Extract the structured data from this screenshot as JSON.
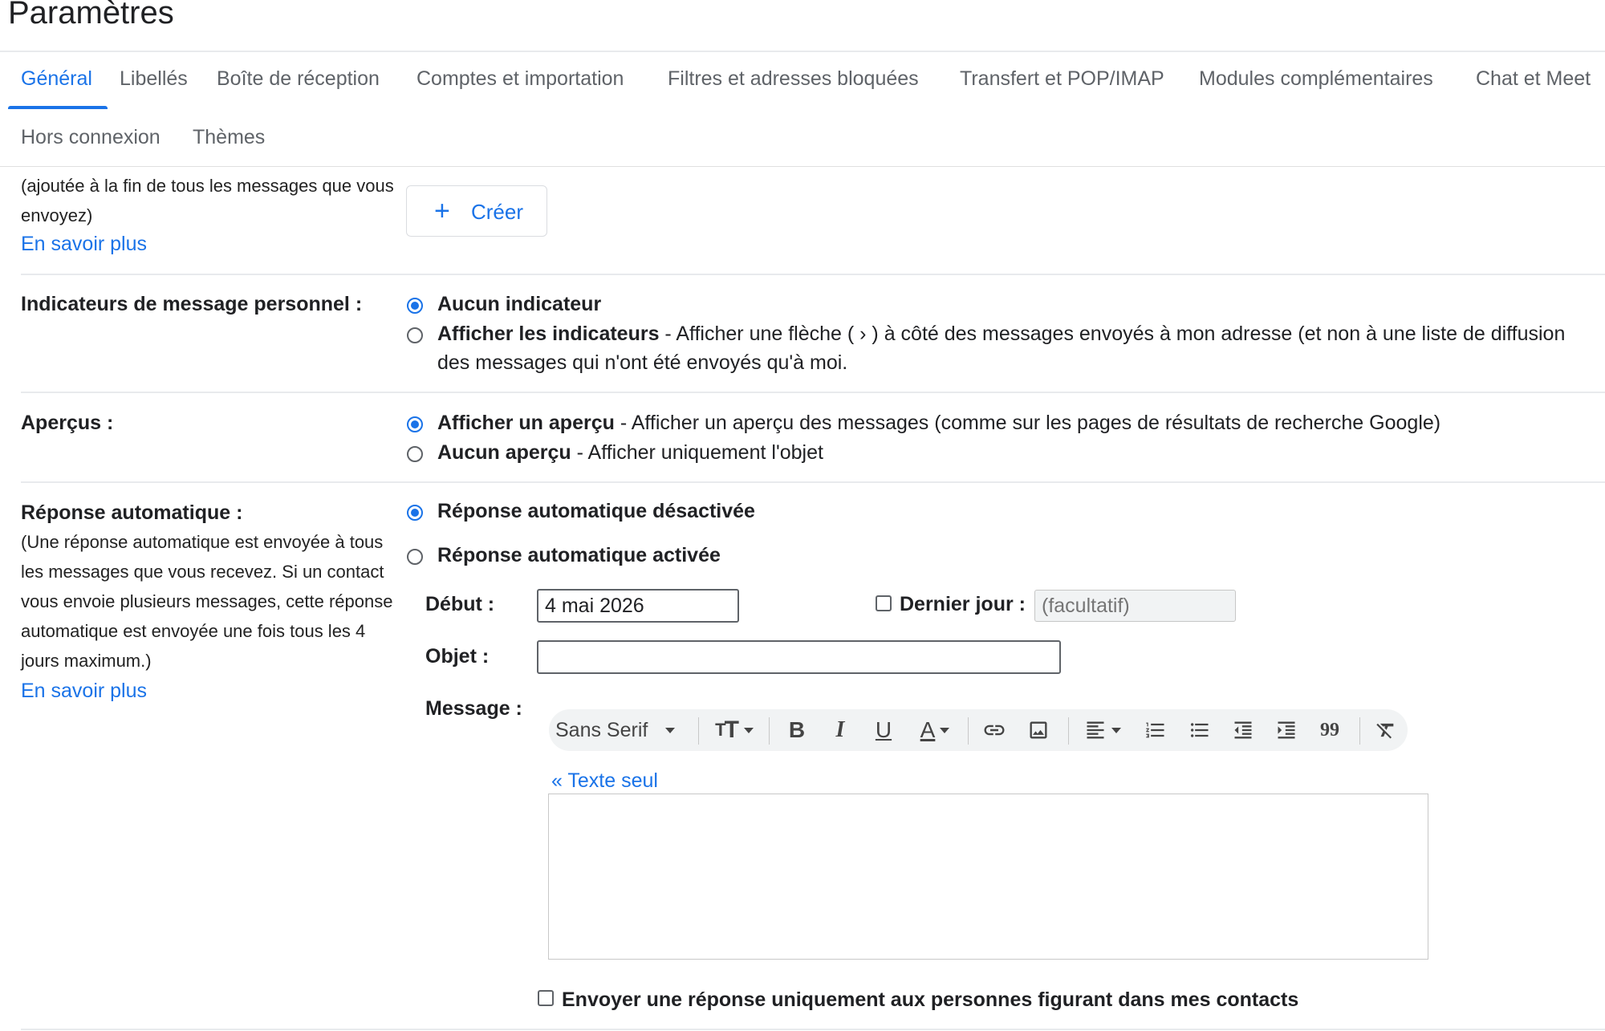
{
  "page": {
    "title": "Paramètres"
  },
  "tabs": [
    {
      "label": "Général",
      "active": true
    },
    {
      "label": "Libellés"
    },
    {
      "label": "Boîte de réception"
    },
    {
      "label": "Comptes et importation"
    },
    {
      "label": "Filtres et adresses bloquées"
    },
    {
      "label": "Transfert et POP/IMAP"
    },
    {
      "label": "Modules complémentaires"
    },
    {
      "label": "Chat et Meet"
    },
    {
      "label": "Hors connexion"
    },
    {
      "label": "Thèmes"
    }
  ],
  "signature": {
    "desc_line1": "(ajoutée à la fin de tous les messages que vous",
    "desc_line2": "envoyez)",
    "learn_more": "En savoir plus",
    "create_label": "Créer"
  },
  "indicators": {
    "label": "Indicateurs de message personnel :",
    "opt1_bold": "Aucun indicateur",
    "opt2_bold": "Afficher les indicateurs",
    "opt2_rest_line1": " - Afficher une flèche ( › ) à côté des messages envoyés à mon adresse (et non à une liste de diffusion",
    "opt2_rest_line2": "des messages qui n'ont été envoyés qu'à moi."
  },
  "previews": {
    "label": "Aperçus :",
    "opt1_bold": "Afficher un aperçu",
    "opt1_rest": " - Afficher un aperçu des messages (comme sur les pages de résultats de recherche Google)",
    "opt2_bold": "Aucun aperçu",
    "opt2_rest": " - Afficher uniquement l'objet"
  },
  "auto_reply": {
    "label": "Réponse automatique :",
    "desc": [
      "(Une réponse automatique est envoyée à tous",
      "les messages que vous recevez. Si un contact",
      "vous envoie plusieurs messages, cette réponse",
      "automatique est envoyée une fois tous les 4",
      "jours maximum.)"
    ],
    "learn_more": "En savoir plus",
    "off_label": "Réponse automatique désactivée",
    "on_label": "Réponse automatique activée",
    "start_label": "Début :",
    "start_value": "4 mai 2026",
    "last_day_label": "Dernier jour :",
    "last_day_placeholder": "(facultatif)",
    "subject_label": "Objet :",
    "subject_value": "",
    "message_label": "Message :",
    "font_name": "Sans Serif",
    "plain_text_link": "« Texte seul",
    "contacts_only_label": "Envoyer une réponse uniquement aux personnes figurant dans mes contacts"
  },
  "toolbar_icons": [
    "font-size-icon",
    "bold-icon",
    "italic-icon",
    "underline-icon",
    "text-color-icon",
    "link-icon",
    "image-icon",
    "align-icon",
    "numbered-list-icon",
    "bulleted-list-icon",
    "indent-less-icon",
    "indent-more-icon",
    "quote-icon",
    "remove-formatting-icon"
  ],
  "colors": {
    "accent": "#1a73e8",
    "text": "#202124",
    "muted": "#5f6368"
  }
}
